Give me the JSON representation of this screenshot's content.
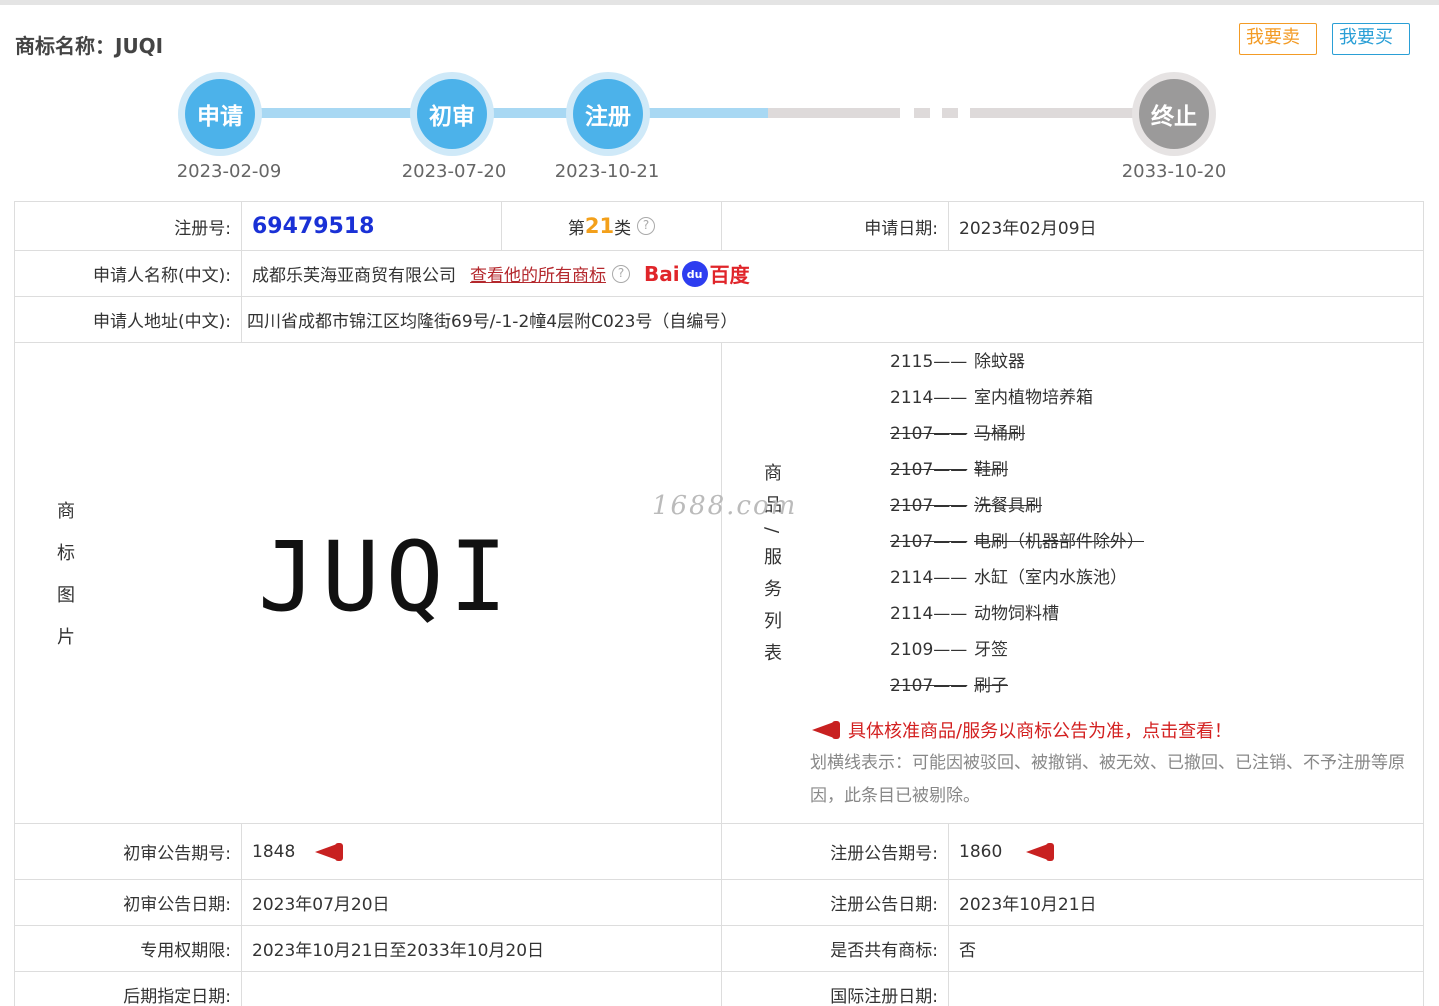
{
  "title": "商标名称：JUQI",
  "actions": {
    "sell": "我要卖",
    "buy": "我要买"
  },
  "timeline": [
    {
      "label": "申请",
      "date": "2023-02-09"
    },
    {
      "label": "初审",
      "date": "2023-07-20"
    },
    {
      "label": "注册",
      "date": "2023-10-21"
    },
    {
      "label": "终止",
      "date": "2033-10-20"
    }
  ],
  "info": {
    "reg_no_label": "注册号:",
    "reg_no": "69479518",
    "class_prefix": "第",
    "class_num": "21",
    "class_suffix": "类",
    "apply_date_label": "申请日期:",
    "apply_date": "2023年02月09日",
    "applicant_label": "申请人名称(中文):",
    "applicant": "成都乐芙海亚商贸有限公司",
    "applicant_link": "查看他的所有商标",
    "baidu_left": "Bai",
    "baidu_paw": "du",
    "baidu_right": "百度",
    "address_label": "申请人地址(中文):",
    "address": "四川省成都市锦江区均隆街69号/-1-2幢4层附C023号（自编号）",
    "image_label": "商标图片",
    "mark_text": "JUQI",
    "goods_label": "商品/服务列表",
    "goods": [
      {
        "code": "2115——",
        "name": "除蚊器",
        "struck": false
      },
      {
        "code": "2114——",
        "name": "室内植物培养箱",
        "struck": false
      },
      {
        "code": "2107——",
        "name": "马桶刷",
        "struck": true
      },
      {
        "code": "2107——",
        "name": "鞋刷",
        "struck": true
      },
      {
        "code": "2107——",
        "name": "洗餐具刷",
        "struck": true
      },
      {
        "code": "2107——",
        "name": "电刷（机器部件除外）",
        "struck": true
      },
      {
        "code": "2114——",
        "name": "水缸（室内水族池）",
        "struck": false
      },
      {
        "code": "2114——",
        "name": "动物饲料槽",
        "struck": false
      },
      {
        "code": "2109——",
        "name": "牙签",
        "struck": false
      },
      {
        "code": "2107——",
        "name": "刷子",
        "struck": true
      }
    ],
    "goods_notice": "具体核准商品/服务以商标公告为准，点击查看！",
    "goods_note": "划横线表示：可能因被驳回、被撤销、被无效、已撤回、已注销、不予注册等原因，此条目已被剔除。",
    "prelim_no_label": "初审公告期号:",
    "prelim_no": "1848",
    "reg_ann_no_label": "注册公告期号:",
    "reg_ann_no": "1860",
    "prelim_date_label": "初审公告日期:",
    "prelim_date": "2023年07月20日",
    "reg_ann_date_label": "注册公告日期:",
    "reg_ann_date": "2023年10月21日",
    "exclusive_label": "专用权期限:",
    "exclusive": "2023年10月21日至2033年10月20日",
    "shared_label": "是否共有商标:",
    "shared": "否",
    "later_label": "后期指定日期:",
    "later": "",
    "intl_label": "国际注册日期:",
    "intl": ""
  },
  "watermark": "1688.com"
}
